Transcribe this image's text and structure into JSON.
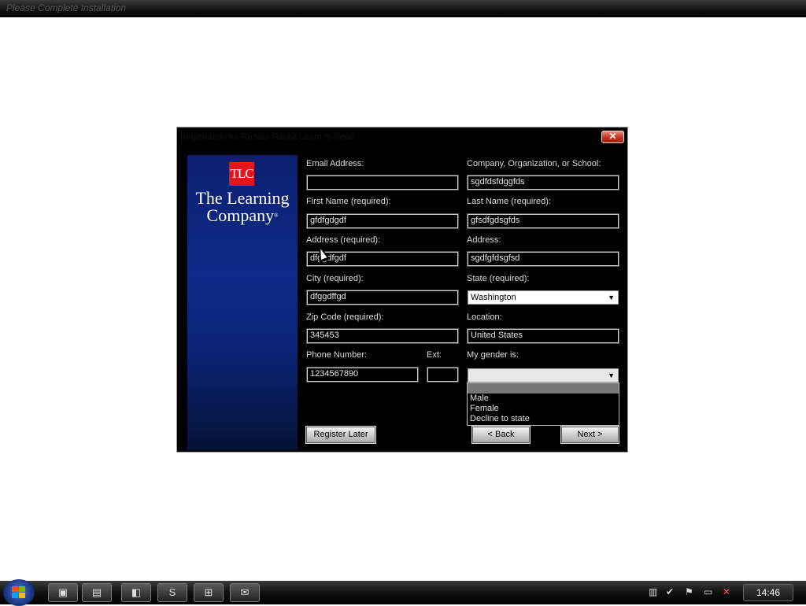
{
  "window": {
    "title": "Please Complete Installation"
  },
  "dialog": {
    "title": "Registration for Reader Rabbit Learn to Read",
    "close_label": "✕",
    "brand": {
      "logo_text": "TLC",
      "name": "The Learning Company",
      "trademark": "®"
    }
  },
  "form": {
    "email": {
      "label": "Email Address:",
      "value": ""
    },
    "company": {
      "label": "Company, Organization, or School:",
      "value": "sgdfdsfdggfds"
    },
    "first_name": {
      "label": "First Name (required):",
      "value": "gfdfgdgdf"
    },
    "last_name": {
      "label": "Last Name (required):",
      "value": "gfsdfgdsgfds"
    },
    "address1": {
      "label": "Address (required):",
      "value": "dfggdfgdf"
    },
    "address2": {
      "label": "Address:",
      "value": "sgdfgfdsgfsd"
    },
    "city": {
      "label": "City (required):",
      "value": "dfggdffgd"
    },
    "state": {
      "label": "State (required):",
      "value": "Washington"
    },
    "zip": {
      "label": "Zip Code (required):",
      "value": "345453"
    },
    "location": {
      "label": "Location:",
      "value": "United States"
    },
    "phone": {
      "label": "Phone Number:",
      "value": "1234567890"
    },
    "ext": {
      "label": "Ext:",
      "value": ""
    },
    "gender": {
      "label": "My gender is:",
      "value": "",
      "options": [
        "Male",
        "Female",
        "Decline to state"
      ]
    }
  },
  "buttons": {
    "register_later": "Register Later",
    "back": "< Back",
    "next": "Next >"
  },
  "taskbar": {
    "clock": "14:46",
    "apps": [
      "app-1",
      "file-manager",
      "app-3",
      "app-4",
      "network",
      "mail"
    ]
  }
}
